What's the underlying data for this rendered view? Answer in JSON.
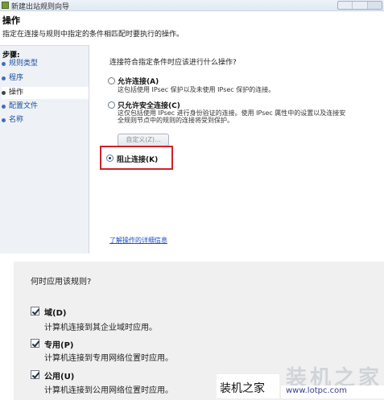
{
  "window": {
    "title": "新建出站规则向导",
    "page_title": "操作",
    "page_subtitle": "指定在连接与规则中指定的条件相匹配时要执行的操作。"
  },
  "steps": {
    "title": "步骤:",
    "items": [
      {
        "label": "规则类型"
      },
      {
        "label": "程序"
      },
      {
        "label": "操作"
      },
      {
        "label": "配置文件"
      },
      {
        "label": "名称"
      }
    ],
    "current_index": 2
  },
  "action": {
    "question": "连接符合指定条件时应该进行什么操作?",
    "options": [
      {
        "label": "允许连接(A)",
        "desc": [
          "这包括使用 IPsec 保护以及未使用 IPsec 保护的连接。"
        ],
        "checked": false
      },
      {
        "label": "只允许安全连接(C)",
        "desc": [
          "这仅包括使用 IPsec 进行身份验证的连接。使用 IPsec 属性中的设置以及连接安",
          "全规则节点中的规则的连接将受到保护。"
        ],
        "checked": false
      },
      {
        "label": "阻止连接(K)",
        "desc": [],
        "checked": true
      }
    ],
    "custom_button": "自定义(Z)...",
    "learn_more_link": "了解操作的详细信息"
  },
  "apply": {
    "question": "何时应用该规则?",
    "profiles": [
      {
        "label": "域(D)",
        "desc": "计算机连接到其企业域时应用。",
        "checked": true
      },
      {
        "label": "专用(P)",
        "desc": "计算机连接到专用网络位置时应用。",
        "checked": true
      },
      {
        "label": "公用(U)",
        "desc": "计算机连接到公用网络位置时应用。",
        "checked": true
      }
    ]
  },
  "watermark": {
    "text": "装机之家",
    "ghost": "装机之家",
    "url": "www.lotpc.com"
  },
  "colors": {
    "highlight": "#d0202a",
    "link": "#1a4fc4",
    "steps_bg": "#eef2f6"
  }
}
